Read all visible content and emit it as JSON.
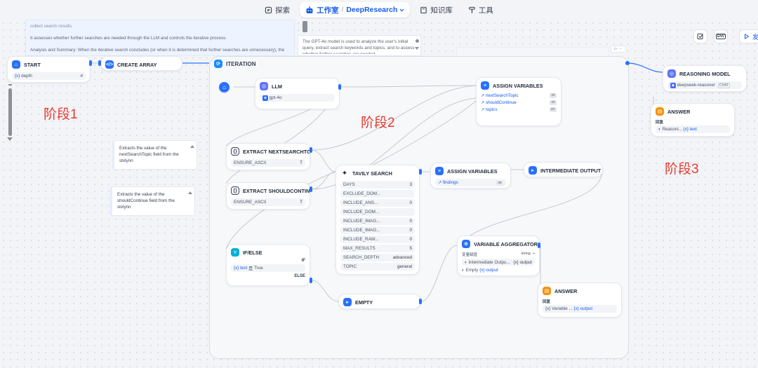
{
  "nav": {
    "explore": "探索",
    "studio": "工作室",
    "app_name": "DeepResearch",
    "knowledge": "知识库",
    "tools": "工具"
  },
  "toolbar": {
    "env_label": "ENV",
    "publish_label": "发"
  },
  "notes": {
    "top_left_1": "collect search results.",
    "top_left_2": "It assesses whether further searches are needed through the LLM and controls the iterative process.",
    "top_left_3": "Analysis and Summary: When the iterative search concludes (or when it is determined that further searches are unnecessary), the deepseek-reasoner model is used to comprehensively analyze and summarize all collected search results.",
    "top_mid": "The GPT-4o model is used to analyze the user's initial query, extract search keywords and topics, and to assess whether further searches are needed.",
    "note_topic": "Extracts the value of the nextSearchTopic field from the stvlynn",
    "note_continue": "Extracts the value of the shouldContinue field from the stvlynn"
  },
  "stages": {
    "s1": "阶段1",
    "s2": "阶段2",
    "s3": "阶段3"
  },
  "nodes": {
    "start": {
      "title": "START",
      "var": "depth",
      "type_badge": "#"
    },
    "create_array": {
      "title": "CREATE ARRAY"
    },
    "iteration": {
      "title": "ITERATION"
    },
    "llm": {
      "title": "LLM",
      "model": "gpt-4o"
    },
    "assign1": {
      "title": "ASSIGN VARIABLES",
      "rows": [
        {
          "name": "nextSearchTopic",
          "tag": "str"
        },
        {
          "name": "shouldContinue",
          "tag": "str"
        },
        {
          "name": "topics",
          "tag": "arr"
        }
      ]
    },
    "extract_topic": {
      "title": "EXTRACT NEXTSEARCHTOPIC",
      "param": "ENSURE_ASCII",
      "val": "T"
    },
    "extract_continue": {
      "title": "EXTRACT SHOULDCONTINUE",
      "param": "ENSURE_ASCII",
      "val": "T"
    },
    "tavily": {
      "title": "TAVILY SEARCH",
      "rows": [
        {
          "k": "DAYS",
          "v": "3"
        },
        {
          "k": "EXCLUDE_DOM...",
          "v": ""
        },
        {
          "k": "INCLUDE_ANS...",
          "v": "0"
        },
        {
          "k": "INCLUDE_DOM...",
          "v": ""
        },
        {
          "k": "INCLUDE_IMAG...",
          "v": "0"
        },
        {
          "k": "INCLUDE_IMAG...",
          "v": "0"
        },
        {
          "k": "INCLUDE_RAW...",
          "v": "0"
        },
        {
          "k": "MAX_RESULTS",
          "v": "5"
        },
        {
          "k": "SEARCH_DEPTH",
          "v": "advanced"
        },
        {
          "k": "TOPIC",
          "v": "general"
        }
      ]
    },
    "assign2": {
      "title": "ASSIGN VARIABLES",
      "row": "findings",
      "tag": "str"
    },
    "intermediate": {
      "title": "INTERMEDIATE OUTPUT FC"
    },
    "ifelse": {
      "title": "IF/ELSE",
      "if": "IF",
      "cond_var": "text",
      "cond_op": "是",
      "cond_val": "True",
      "else": "ELSE"
    },
    "empty": {
      "title": "EMPTY"
    },
    "aggregator": {
      "title": "VARIABLE AGGREGATOR",
      "label": "变量赋值",
      "type": "string",
      "rows": [
        {
          "src": "Intermediate Outpu...",
          "var": "output"
        },
        {
          "src": "Empty",
          "var": "output"
        }
      ]
    },
    "answer_inner": {
      "title": "ANSWER",
      "label": "回复",
      "src": "Variable ...",
      "var": "output"
    },
    "reasoning": {
      "title": "REASONING MODEL",
      "model": "deepseek-reasoner",
      "badge": "CHAT"
    },
    "answer_outer": {
      "title": "ANSWER",
      "label": "回复",
      "src": "Reasoni...",
      "var": "text"
    }
  },
  "colors": {
    "accent": "#155aef",
    "edge": "#c4cad3",
    "stage_label": "#e8392f"
  }
}
